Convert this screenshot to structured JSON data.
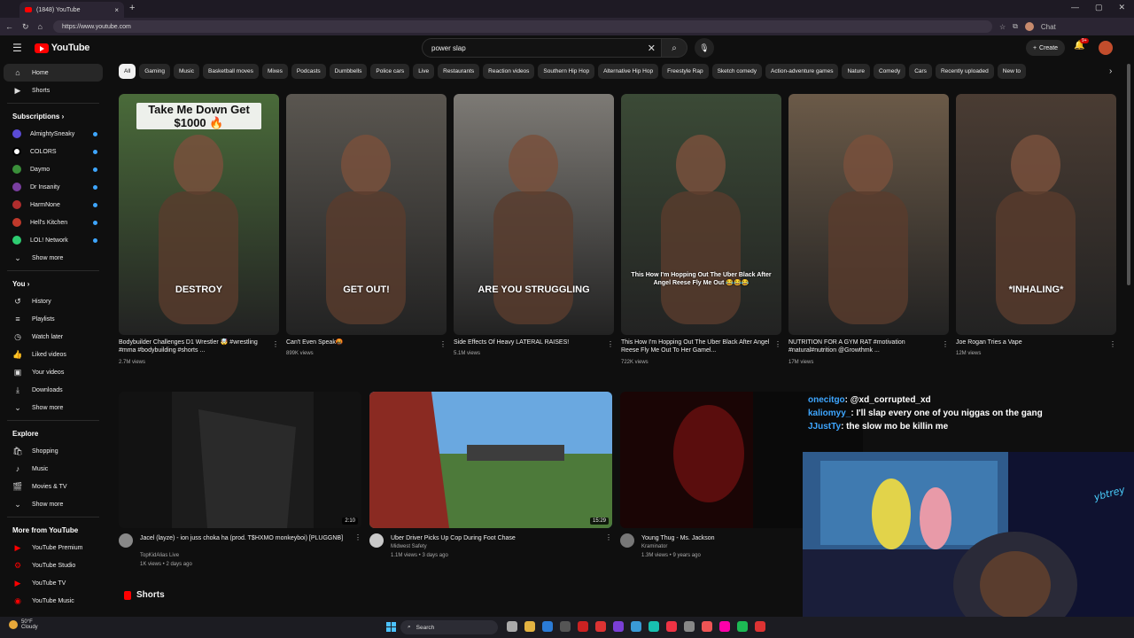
{
  "browser": {
    "tab_title": "(1848) YouTube",
    "url": "https://www.youtube.com",
    "chat_label": "Chat"
  },
  "header": {
    "logo_text": "YouTube",
    "search_value": "power slap",
    "create_label": "Create",
    "notif_badge": "9+"
  },
  "sidebar": {
    "main": [
      {
        "label": "Home",
        "icon": "home-icon"
      },
      {
        "label": "Shorts",
        "icon": "shorts-icon"
      }
    ],
    "subscriptions_title": "Subscriptions",
    "subscriptions": [
      {
        "label": "AlmightySneaky",
        "color": "#5b4bd6"
      },
      {
        "label": "COLORS",
        "color": "#ffffff"
      },
      {
        "label": "Daymo",
        "color": "#3a8f3a"
      },
      {
        "label": "Dr Insanity",
        "color": "#7a3fa0"
      },
      {
        "label": "HarmNone",
        "color": "#b02d2d"
      },
      {
        "label": "Hell's Kitchen",
        "color": "#c0392b"
      },
      {
        "label": "LOL! Network",
        "color": "#2ecc71"
      }
    ],
    "show_more": "Show more",
    "you_title": "You",
    "you_items": [
      {
        "label": "History",
        "icon": "history-icon"
      },
      {
        "label": "Playlists",
        "icon": "playlists-icon"
      },
      {
        "label": "Watch later",
        "icon": "watch-later-icon"
      },
      {
        "label": "Liked videos",
        "icon": "liked-icon"
      },
      {
        "label": "Your videos",
        "icon": "your-videos-icon"
      },
      {
        "label": "Downloads",
        "icon": "downloads-icon"
      }
    ],
    "show_more_2": "Show more",
    "explore_title": "Explore",
    "explore_items": [
      {
        "label": "Shopping",
        "icon": "shopping-icon"
      },
      {
        "label": "Music",
        "icon": "music-icon"
      },
      {
        "label": "Movies & TV",
        "icon": "movies-icon"
      }
    ],
    "show_more_3": "Show more",
    "more_title": "More from YouTube",
    "more_items": [
      {
        "label": "YouTube Premium"
      },
      {
        "label": "YouTube Studio"
      },
      {
        "label": "YouTube TV"
      },
      {
        "label": "YouTube Music"
      }
    ]
  },
  "chips": [
    "All",
    "Gaming",
    "Music",
    "Basketball moves",
    "Mixes",
    "Podcasts",
    "Dumbbells",
    "Police cars",
    "Live",
    "Restaurants",
    "Reaction videos",
    "Southern Hip Hop",
    "Alternative Hip Hop",
    "Freestyle Rap",
    "Sketch comedy",
    "Action-adventure games",
    "Nature",
    "Comedy",
    "Cars",
    "Recently uploaded",
    "New to"
  ],
  "shorts_row": [
    {
      "title": "Bodybuilder Challenges D1 Wrestler 🤯 #wrestling #mma #bodybuilding #shorts ...",
      "views": "2.7M views",
      "overlay_top": "Take Me Down Get $1000 🔥",
      "overlay_bottom": "DESTROY",
      "bg": "#4a6b3a"
    },
    {
      "title": "Can't Even Speak🤬",
      "views": "899K views",
      "overlay_top": "",
      "overlay_bottom": "GET OUT!",
      "bg": "#5a5650"
    },
    {
      "title": "Side Effects Of Heavy LATERAL RAISES!",
      "views": "5.1M views",
      "overlay_top": "",
      "overlay_bottom": "ARE YOU STRUGGLING",
      "bg": "#7d7a75"
    },
    {
      "title": "This How I'm Hopping Out The Uber Black After Angel Reese Fly Me Out To Her Gamel...",
      "views": "722K views",
      "overlay_top": "",
      "overlay_bottom": "This How I'm Hopping Out The Uber Black After Angel Reese Fly Me Out 😂😂😂",
      "bg": "#3b4a36"
    },
    {
      "title": "NUTRITION FOR A GYM RAT #motivation #natural#nutrition @Growthmk ...",
      "views": "17M views",
      "overlay_top": "",
      "overlay_bottom": "",
      "bg": "#6b5a48"
    },
    {
      "title": "Joe Rogan Tries a Vape",
      "views": "12M views",
      "overlay_top": "",
      "overlay_bottom": "*INHALING*",
      "bg": "#4a3c33"
    }
  ],
  "videos_row": [
    {
      "title": "Jacel (layze) - ion juss choka ha (prod. T$HXMO monkeyboi) [PLUGGNB]",
      "channel": "TopKidAlias Live",
      "meta": "1K views • 2 days ago",
      "duration": "2:10",
      "bg": "#121212",
      "av": "#888"
    },
    {
      "title": "Uber Driver Picks Up Cop During Foot Chase",
      "channel": "Midwest Safety",
      "meta": "1.1M views • 3 days ago",
      "duration": "15:29",
      "bg": "#2a6a9a",
      "av": "#c9c9c9"
    },
    {
      "title": "Young Thug - Ms. Jackson",
      "channel": "Kraminator",
      "meta": "1.3M views • 9 years ago",
      "duration": "",
      "bg": "#1a0505",
      "av": "#777"
    }
  ],
  "shorts_section_title": "Shorts",
  "chat_overlay": [
    {
      "user": "onecitgo",
      "text": ": @xd_corrupted_xd"
    },
    {
      "user": "kaliomyy_",
      "text": ": I'll slap every one of you niggas on the gang"
    },
    {
      "user": "JJustTy",
      "text": ": the slow mo be killin me"
    }
  ],
  "taskbar": {
    "weather_temp": "50°F",
    "weather_desc": "Cloudy",
    "search_label": "Search"
  }
}
